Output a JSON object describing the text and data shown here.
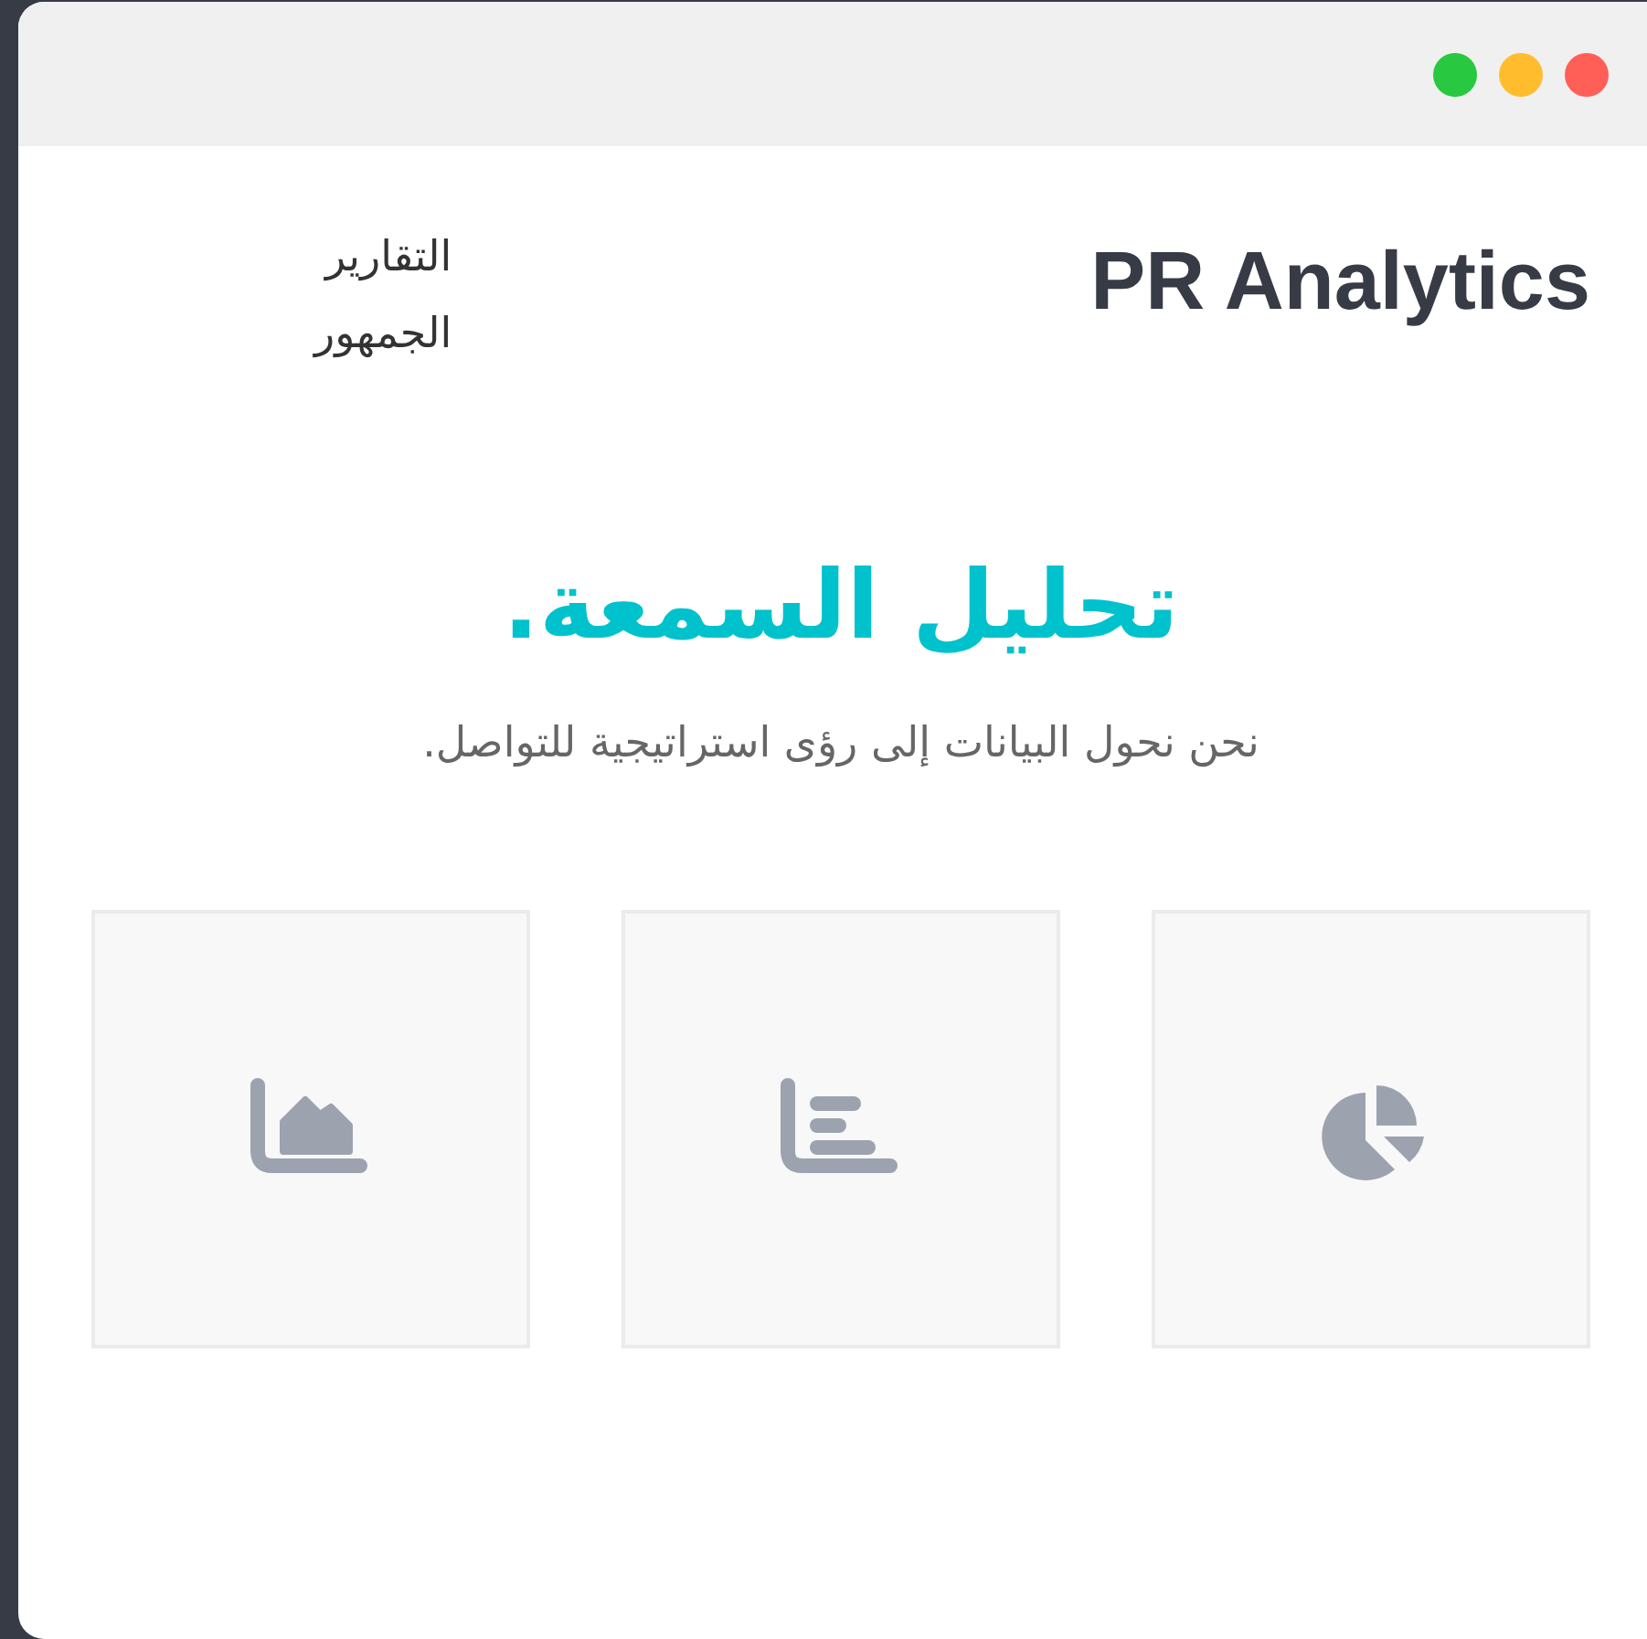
{
  "window_controls": [
    {
      "color": "#ff5f57"
    },
    {
      "color": "#ffbd2e"
    },
    {
      "color": "#28c840"
    }
  ],
  "header": {
    "logo": "PR Analytics",
    "nav": [
      "التقارير",
      "الجمهور"
    ]
  },
  "hero": {
    "title": "تحليل السمعة.",
    "subtitle": "نحن نحول البيانات إلى رؤى استراتيجية للتواصل."
  },
  "cards": [
    {
      "kind": "pie"
    },
    {
      "kind": "bar"
    },
    {
      "kind": "area"
    }
  ]
}
